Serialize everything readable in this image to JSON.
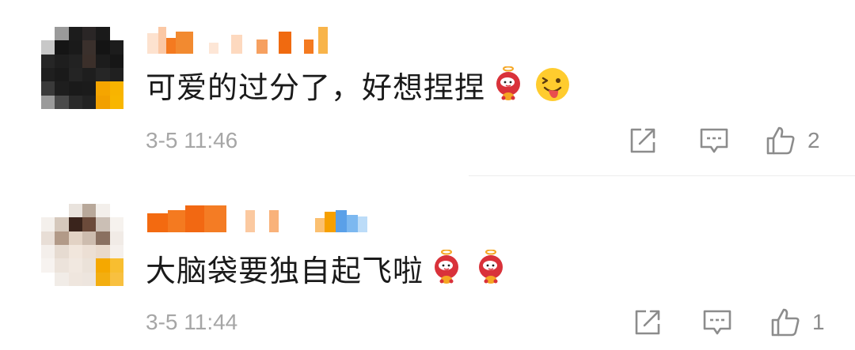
{
  "comments": [
    {
      "text": "可爱的过分了，好想捏捏",
      "emojis": [
        "apple-mascot-emoji",
        "wink-tongue-emoji"
      ],
      "timestamp": "3-5 11:46",
      "likes": "2",
      "avatar": "pixelated-avatar",
      "username": "pixelated-username"
    },
    {
      "text": "大脑袋要独自起飞啦",
      "emojis": [
        "apple-mascot-emoji",
        "apple-mascot-emoji"
      ],
      "timestamp": "3-5 11:44",
      "likes": "1",
      "avatar": "pixelated-avatar",
      "username": "pixelated-username"
    }
  ],
  "icons": {
    "share": "share-icon",
    "reply": "comment-icon",
    "like": "thumbs-up-icon"
  },
  "colors": {
    "text": "#1a1a1a",
    "meta": "#a6a6a6",
    "icon": "#8c8c8c",
    "brand_orange": "#f07a1a"
  }
}
